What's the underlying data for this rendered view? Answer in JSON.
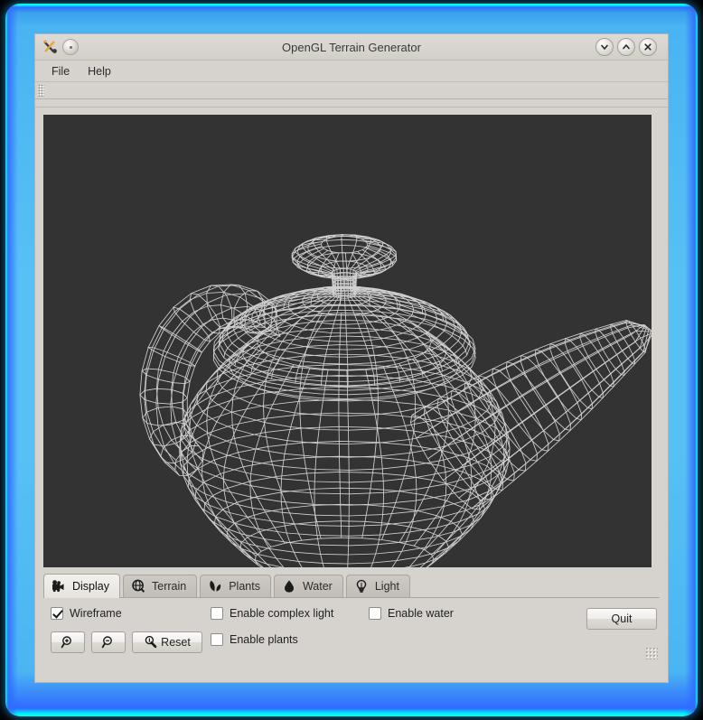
{
  "window": {
    "title": "OpenGL Terrain Generator",
    "app_icon": "app-logo-icon",
    "menu_button_icon": "window-menu-icon",
    "controls": [
      {
        "name": "minimize",
        "icon": "chevron-down-icon"
      },
      {
        "name": "maximize",
        "icon": "chevron-up-icon"
      },
      {
        "name": "close",
        "icon": "close-x-icon"
      }
    ]
  },
  "menubar": {
    "items": [
      {
        "label": "File"
      },
      {
        "label": "Help"
      }
    ]
  },
  "toolbar": {
    "grip_icon": "drag-handle-icon"
  },
  "viewport": {
    "name": "opengl-render-canvas",
    "background": "#333333",
    "wire_color": "#d8d8d8",
    "model": "Utah teapot wireframe"
  },
  "tabs": [
    {
      "label": "Display",
      "icon": "camera-icon",
      "active": true
    },
    {
      "label": "Terrain",
      "icon": "globe-icon",
      "active": false
    },
    {
      "label": "Plants",
      "icon": "leaves-icon",
      "active": false
    },
    {
      "label": "Water",
      "icon": "droplet-icon",
      "active": false
    },
    {
      "label": "Light",
      "icon": "lightbulb-icon",
      "active": false
    }
  ],
  "display_panel": {
    "checkboxes": [
      {
        "label": "Wireframe",
        "checked": true
      },
      {
        "label": "Enable complex light",
        "checked": false
      },
      {
        "label": "Enable water",
        "checked": false
      },
      {
        "label": "Enable plants",
        "checked": false
      }
    ],
    "buttons": [
      {
        "label": "",
        "icon": "zoom-in-icon",
        "name": "zoom-in-button"
      },
      {
        "label": "",
        "icon": "zoom-out-icon",
        "name": "zoom-out-button"
      },
      {
        "label": "Reset",
        "icon": "zoom-reset-icon",
        "name": "reset-button"
      }
    ],
    "quit_label": "Quit"
  },
  "colors": {
    "frame_glow": "#3aa0ef",
    "frame_edge": "#00ffe8",
    "chrome": "#d6d3ce",
    "canvas": "#333333"
  }
}
